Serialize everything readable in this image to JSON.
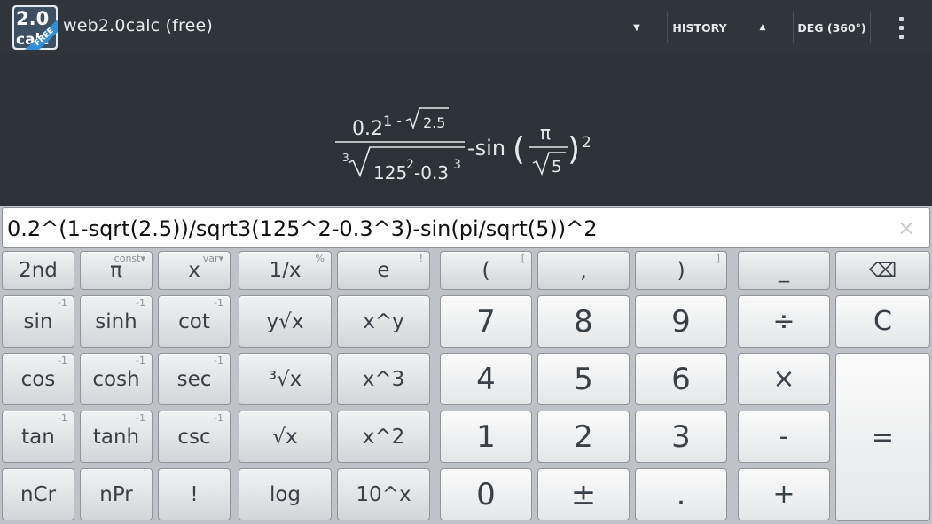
{
  "app": {
    "title": "web2.0calc (free)",
    "logo_number": "2.0",
    "logo_text": "calc",
    "logo_ribbon": "FREE"
  },
  "actionbar": {
    "dropdown_icon": "triangle-down-icon",
    "history_label": "HISTORY",
    "up_icon": "triangle-up-icon",
    "angle_mode_label": "DEG (360°)",
    "overflow_icon": "overflow-menu-icon"
  },
  "display": {
    "numerator_base": "0.2",
    "numerator_exp_prefix": "1 -",
    "numerator_exp_radicand": "2.5",
    "denominator_index": "3",
    "denominator_radicand_base1": "125",
    "denominator_exp1": "2",
    "denominator_minus": "-0.3",
    "denominator_exp2": "3",
    "minus_sin": "-sin",
    "inner_numerator": "π",
    "inner_denominator_radicand": "5",
    "outer_exponent": "2"
  },
  "input": {
    "value": "0.2^(1-sqrt(2.5))/sqrt3(125^2-0.3^3)-sin(pi/sqrt(5))^2",
    "clear_icon": "clear-x-icon",
    "clear_glyph": "×"
  },
  "keys": {
    "row1": [
      {
        "id": "second",
        "label": "2nd",
        "sup": ""
      },
      {
        "id": "pi",
        "label": "π",
        "sup": "const▾"
      },
      {
        "id": "x-var",
        "label": "x",
        "sup": "var▾"
      },
      {
        "id": "reciprocal",
        "label": "1/x",
        "sup": "%"
      },
      {
        "id": "e",
        "label": "e",
        "sup": "!"
      },
      {
        "id": "open-paren",
        "label": "(",
        "sup": "["
      },
      {
        "id": "comma",
        "label": ",",
        "sup": ""
      },
      {
        "id": "close-paren",
        "label": ")",
        "sup": "]"
      },
      {
        "id": "underscore",
        "label": "_",
        "sup": ""
      },
      {
        "id": "backspace",
        "label": "⌫",
        "sup": ""
      }
    ],
    "row2": [
      {
        "id": "sin",
        "label": "sin",
        "sup": "-1"
      },
      {
        "id": "sinh",
        "label": "sinh",
        "sup": "-1"
      },
      {
        "id": "cot",
        "label": "cot",
        "sup": "-1"
      },
      {
        "id": "y-root-x",
        "label": "y√x",
        "sup": ""
      },
      {
        "id": "x-pow-y",
        "label": "x^y",
        "sup": ""
      },
      {
        "id": "seven",
        "label": "7",
        "sup": ""
      },
      {
        "id": "eight",
        "label": "8",
        "sup": ""
      },
      {
        "id": "nine",
        "label": "9",
        "sup": ""
      },
      {
        "id": "divide",
        "label": "÷",
        "sup": ""
      },
      {
        "id": "clear",
        "label": "C",
        "sup": ""
      }
    ],
    "row3": [
      {
        "id": "cos",
        "label": "cos",
        "sup": "-1"
      },
      {
        "id": "cosh",
        "label": "cosh",
        "sup": "-1"
      },
      {
        "id": "sec",
        "label": "sec",
        "sup": "-1"
      },
      {
        "id": "cube-root",
        "label": "³√x",
        "sup": ""
      },
      {
        "id": "x-cubed",
        "label": "x^3",
        "sup": ""
      },
      {
        "id": "four",
        "label": "4",
        "sup": ""
      },
      {
        "id": "five",
        "label": "5",
        "sup": ""
      },
      {
        "id": "six",
        "label": "6",
        "sup": ""
      },
      {
        "id": "multiply",
        "label": "×",
        "sup": ""
      }
    ],
    "row4": [
      {
        "id": "tan",
        "label": "tan",
        "sup": "-1"
      },
      {
        "id": "tanh",
        "label": "tanh",
        "sup": "-1"
      },
      {
        "id": "csc",
        "label": "csc",
        "sup": "-1"
      },
      {
        "id": "sqrt",
        "label": "√x",
        "sup": ""
      },
      {
        "id": "x-squared",
        "label": "x^2",
        "sup": ""
      },
      {
        "id": "one",
        "label": "1",
        "sup": ""
      },
      {
        "id": "two",
        "label": "2",
        "sup": ""
      },
      {
        "id": "three",
        "label": "3",
        "sup": ""
      },
      {
        "id": "minus",
        "label": "-",
        "sup": ""
      },
      {
        "id": "equals",
        "label": "=",
        "sup": ""
      }
    ],
    "row5": [
      {
        "id": "ncr",
        "label": "nCr",
        "sup": ""
      },
      {
        "id": "npr",
        "label": "nPr",
        "sup": ""
      },
      {
        "id": "factorial",
        "label": "!",
        "sup": ""
      },
      {
        "id": "log",
        "label": "log",
        "sup": ""
      },
      {
        "id": "ten-pow-x",
        "label": "10^x",
        "sup": ""
      },
      {
        "id": "zero",
        "label": "0",
        "sup": ""
      },
      {
        "id": "plus-minus",
        "label": "±",
        "sup": ""
      },
      {
        "id": "decimal",
        "label": ".",
        "sup": ""
      },
      {
        "id": "plus",
        "label": "+",
        "sup": ""
      }
    ]
  },
  "colors": {
    "actionbar_bg": "#2f353b",
    "display_bg": "#2c3238",
    "keypad_bg": "#bfc3c8",
    "logo_accent": "#2f8fd8"
  }
}
